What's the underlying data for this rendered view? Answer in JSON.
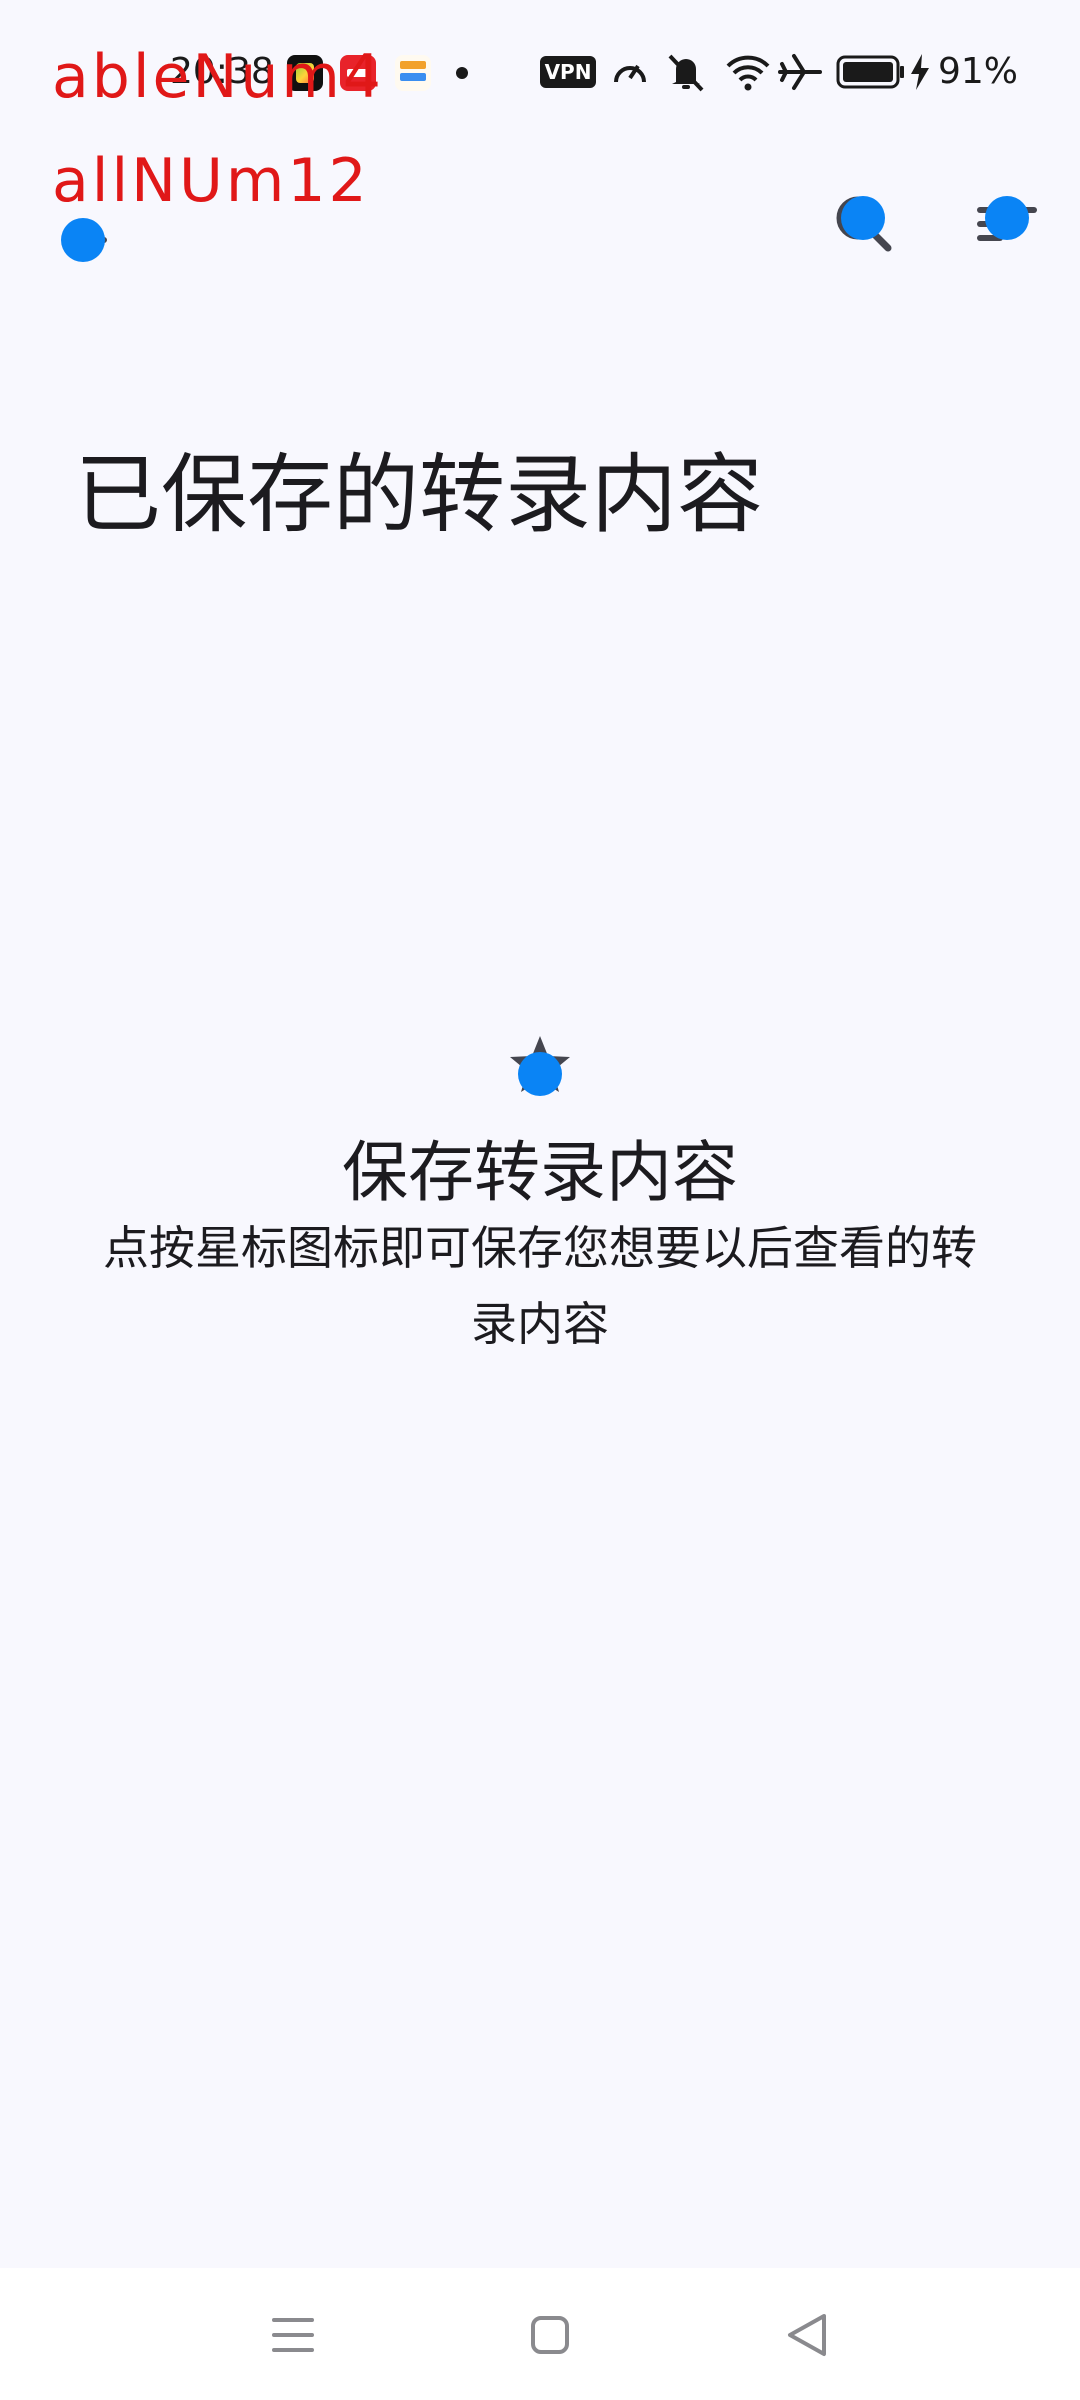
{
  "status_bar": {
    "time": "20:38",
    "vpn_label": "VPN",
    "battery_percent": "91%",
    "icons": [
      "app-icon",
      "app-icon",
      "app-icon",
      "notification-dot",
      "vpn-icon",
      "speed-icon",
      "mute-icon",
      "wifi-icon",
      "airplane-icon",
      "battery-icon",
      "charging-icon"
    ]
  },
  "overlay": {
    "line1": "ableNum4",
    "line2": "allNUm12"
  },
  "top_bar": {
    "icons": [
      "back-arrow-icon",
      "search-icon",
      "sort-icon"
    ]
  },
  "page": {
    "title": "已保存的转录内容"
  },
  "empty_state": {
    "icon": "star-icon",
    "title": "保存转录内容",
    "description": "点按星标图标即可保存您想要以后查看的转录内容"
  },
  "system_nav": {
    "icons": [
      "menu-icon",
      "home-icon",
      "back-icon"
    ]
  },
  "colors": {
    "background": "#f8f8fe",
    "text": "#1c1b1f",
    "overlay_text": "#e01818",
    "touch_dot": "#0a84f5",
    "icon": "#45464f"
  }
}
